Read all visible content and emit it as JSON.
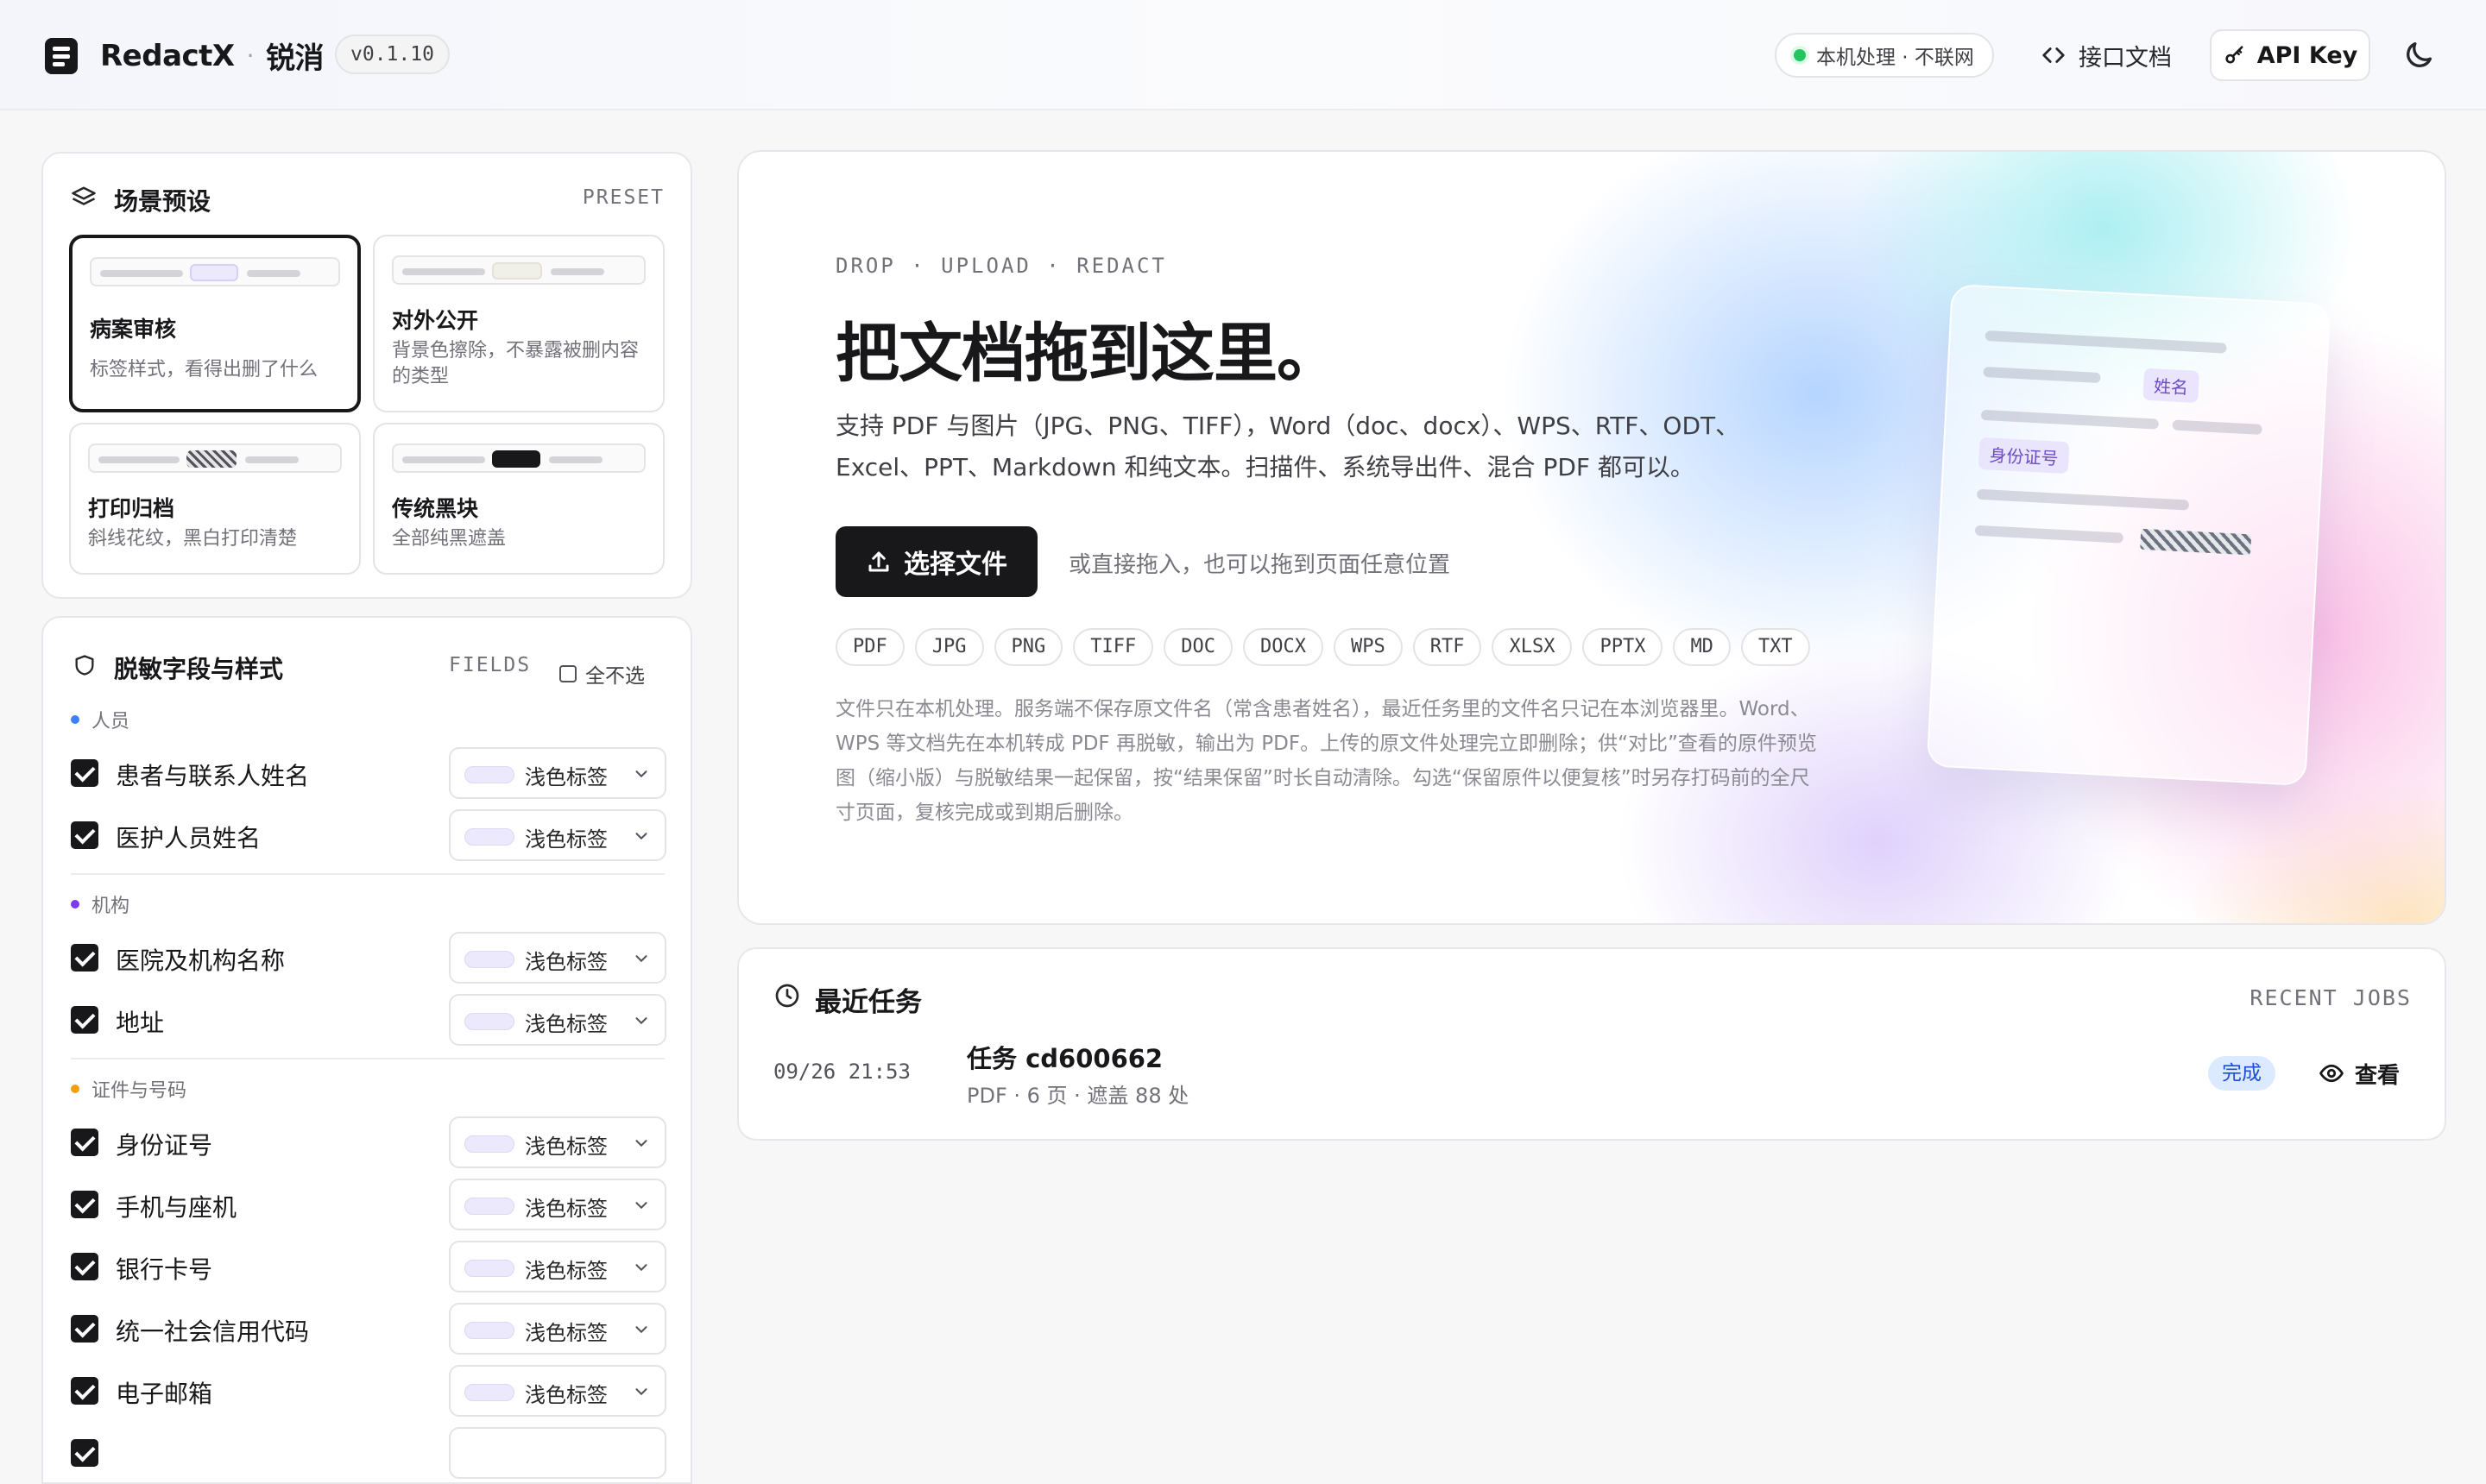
{
  "header": {
    "brand": "RedactX",
    "brand_sep": "·",
    "brand_cn": "锐消",
    "version": "v0.1.10",
    "status": "本机处理 · 不联网",
    "api_doc": "接口文档",
    "api_key": "API Key"
  },
  "presets": {
    "title": "场景预设",
    "tag": "PRESET",
    "items": [
      {
        "name": "病案审核",
        "desc": "标签样式，看得出删了什么",
        "active": true
      },
      {
        "name": "对外公开",
        "desc": "背景色擦除，不暴露被删内容的类型",
        "active": false
      },
      {
        "name": "打印归档",
        "desc": "斜线花纹，黑白打印清楚",
        "active": false
      },
      {
        "name": "传统黑块",
        "desc": "全部纯黑遮盖",
        "active": false
      }
    ]
  },
  "fields": {
    "title": "脱敏字段与样式",
    "tag": "FIELDS",
    "select_all": "全不选",
    "style_label": "浅色标签",
    "groups": [
      {
        "label": "人员",
        "color": "#3b82f6",
        "items": [
          "患者与联系人姓名",
          "医护人员姓名"
        ]
      },
      {
        "label": "机构",
        "color": "#7c3aed",
        "items": [
          "医院及机构名称",
          "地址"
        ]
      },
      {
        "label": "证件与号码",
        "color": "#f59e0b",
        "items": [
          "身份证号",
          "手机与座机",
          "银行卡号",
          "统一社会信用代码",
          "电子邮箱"
        ]
      }
    ]
  },
  "hero": {
    "eyebrow": "DROP · UPLOAD · REDACT",
    "title": "把文档拖到这里。",
    "subtitle": "支持 PDF 与图片（JPG、PNG、TIFF），Word（doc、docx）、WPS、RTF、ODT、Excel、PPT、Markdown 和纯文本。扫描件、系统导出件、混合 PDF 都可以。",
    "button": "选择文件",
    "drop_hint": "或直接拖入，也可以拖到页面任意位置",
    "file_types": [
      "PDF",
      "JPG",
      "PNG",
      "TIFF",
      "DOC",
      "DOCX",
      "WPS",
      "RTF",
      "XLSX",
      "PPTX",
      "MD",
      "TXT"
    ],
    "note": "文件只在本机处理。服务端不保存原文件名（常含患者姓名），最近任务里的文件名只记在本浏览器里。Word、WPS 等文档先在本机转成 PDF 再脱敏，输出为 PDF。上传的原文件处理完立即删除；供“对比”查看的原件预览图（缩小版）与脱敏结果一起保留，按“结果保留”时长自动清除。勾选“保留原件以便复核”时另存打码前的全尺寸页面，复核完成或到期后删除。",
    "mock_tag_name": "姓名",
    "mock_tag_id": "身份证号"
  },
  "jobs": {
    "title": "最近任务",
    "tag": "RECENT JOBS",
    "items": [
      {
        "time": "09/26 21:53",
        "name": "任务 cd600662",
        "meta": "PDF · 6 页 · 遮盖 88 处",
        "status": "完成",
        "action": "查看"
      }
    ]
  }
}
